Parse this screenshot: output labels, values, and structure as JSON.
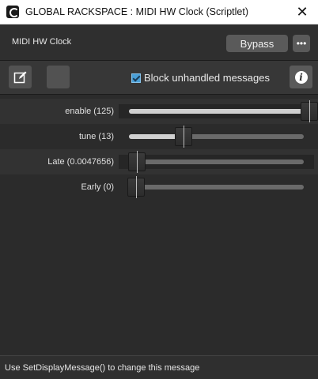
{
  "window": {
    "title": "GLOBAL RACKSPACE : MIDI HW Clock (Scriptlet)",
    "close_glyph": "✕",
    "icon": "gig-performer-icon"
  },
  "header": {
    "plugin_name": "MIDI HW Clock",
    "bypass_label": "Bypass",
    "more_label": "•••"
  },
  "toolbar": {
    "edit_icon": "edit-icon",
    "checkbox_label": "Block unhandled messages",
    "checkbox_checked": true,
    "info_glyph": "i"
  },
  "params": [
    {
      "label": "enable (125)",
      "value": 0.98
    },
    {
      "label": "tune (13)",
      "value": 0.27
    },
    {
      "label": "Late (0.0047656)",
      "value": 0.005
    },
    {
      "label": "Early (0)",
      "value": 0.0
    }
  ],
  "status": {
    "message": "Use SetDisplayMessage() to change this message"
  },
  "colors": {
    "background": "#2b2b2b",
    "accent": "#4aa0d8",
    "button": "#5a5a5a"
  }
}
